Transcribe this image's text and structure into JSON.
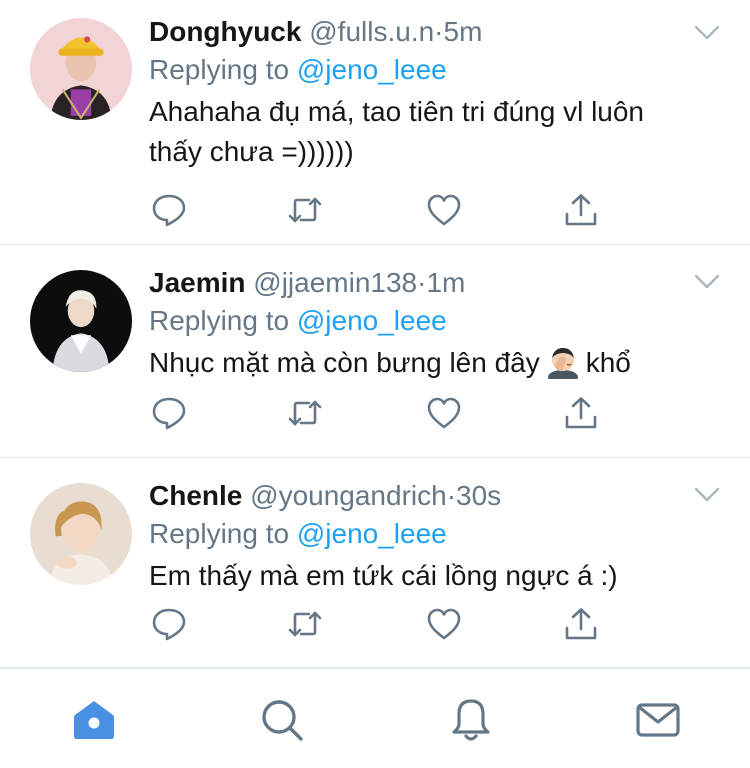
{
  "tweets": [
    {
      "name": "Donghyuck",
      "handle": "@fulls.u.n",
      "separator": "·",
      "time": "5m",
      "replying_prefix": "Replying to",
      "replying_to": "@jeno_leee",
      "text_line1": "Ahahaha đụ má, tao tiên tri đúng vl luôn",
      "text_line2": "thấy chưa =))))))"
    },
    {
      "name": "Jaemin",
      "handle": "@jjaemin138",
      "separator": "·",
      "time": "1m",
      "replying_prefix": "Replying to",
      "replying_to": "@jeno_leee",
      "text_before_emoji": "Nhục mặt mà còn bưng lên đây",
      "text_after_emoji": "khổ",
      "emoji": "man-facepalming-emoji"
    },
    {
      "name": "Chenle",
      "handle": "@youngandrich",
      "separator": "·",
      "time": "30s",
      "replying_prefix": "Replying to",
      "replying_to": "@jeno_leee",
      "text_line1": "Em thấy mà em tứk cái lồng ngực á :)"
    }
  ],
  "action_icons": [
    "reply-icon",
    "retweet-icon",
    "like-icon",
    "share-icon"
  ],
  "tabs": [
    {
      "icon": "home-icon",
      "active": true
    },
    {
      "icon": "search-icon",
      "active": false
    },
    {
      "icon": "notifications-icon",
      "active": false
    },
    {
      "icon": "messages-icon",
      "active": false
    }
  ],
  "colors": {
    "accent": "#1da1f2",
    "muted": "#657786",
    "text": "#14171a",
    "divider": "#e1e8ed",
    "tab_active": "#4a90e2",
    "icon": "#657786"
  }
}
